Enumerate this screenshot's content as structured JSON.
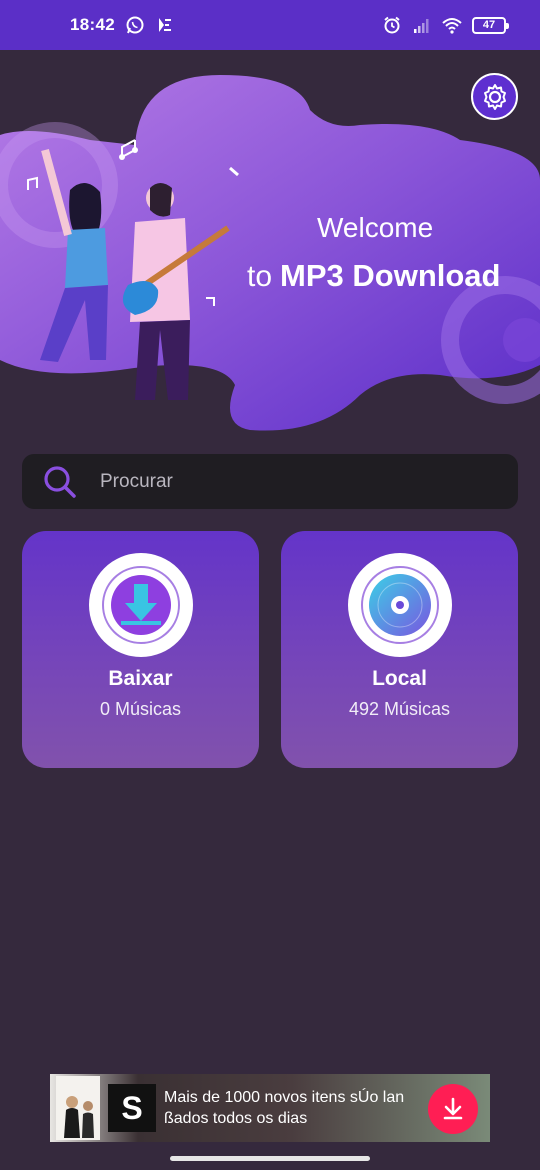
{
  "status_bar": {
    "time": "18:42",
    "battery": "47"
  },
  "banner": {
    "welcome": "Welcome",
    "to": "to",
    "app_name": "MP3 Download"
  },
  "search": {
    "placeholder": "Procurar"
  },
  "cards": [
    {
      "title": "Baixar",
      "count": "0 Músicas",
      "icon": "download-icon"
    },
    {
      "title": "Local",
      "count": "492 Músicas",
      "icon": "disc-icon"
    }
  ],
  "ad": {
    "logo": "S",
    "text": "Mais de 1000 novos itens sÚo lan ßados todos os dias"
  },
  "colors": {
    "status_bar": "#5b2fc7",
    "background": "#35293d",
    "card": "#6a3bc6",
    "accent": "#ff1e54"
  }
}
